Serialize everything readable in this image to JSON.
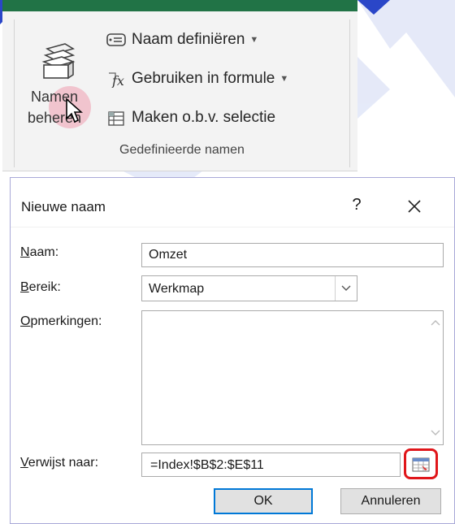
{
  "ribbon": {
    "big_button": {
      "line1": "Namen",
      "line2": "beheren"
    },
    "commands": [
      {
        "label": "Naam definiëren",
        "has_dropdown": true,
        "icon": "name-tag-icon"
      },
      {
        "label": "Gebruiken in formule",
        "has_dropdown": true,
        "icon": "fx-icon"
      },
      {
        "label": "Maken o.b.v. selectie",
        "has_dropdown": false,
        "icon": "create-from-selection-icon"
      }
    ],
    "group_title": "Gedefinieerde namen",
    "accent_color": "#217346"
  },
  "dialog": {
    "title": "Nieuwe naam",
    "help": "?",
    "fields": {
      "naam": {
        "label_key": "N",
        "label_rest": "aam:",
        "value": "Omzet"
      },
      "bereik": {
        "label_key": "B",
        "label_rest": "ereik:",
        "value": "Werkmap"
      },
      "opmerkingen": {
        "label_key": "O",
        "label_rest": "pmerkingen:",
        "value": ""
      },
      "verwijst": {
        "label_key": "V",
        "label_rest": "erwijst naar:",
        "value": "=Index!$B$2:$E$11"
      }
    },
    "buttons": {
      "ok": "OK",
      "cancel": "Annuleren"
    },
    "highlight_color": "#e0161a",
    "ok_border_color": "#0078d7"
  }
}
